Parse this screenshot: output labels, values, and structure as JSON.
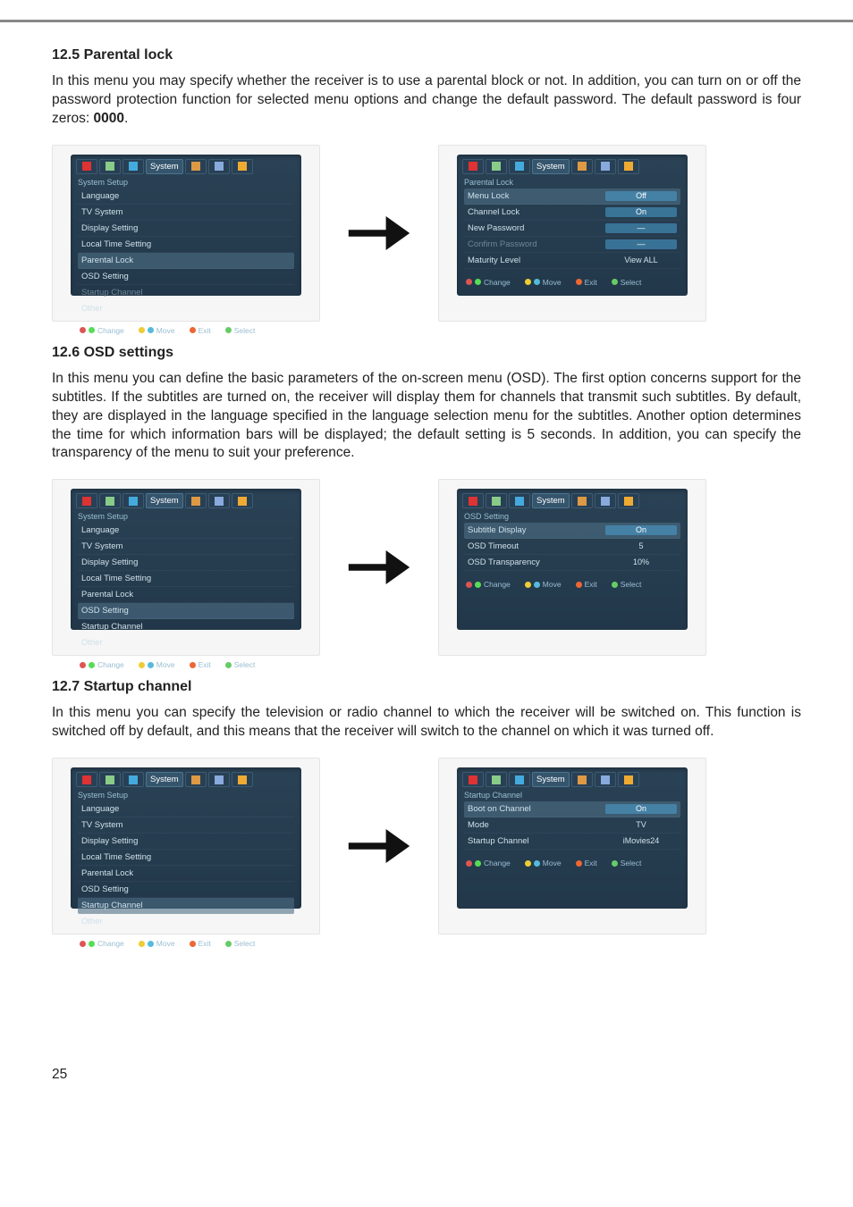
{
  "sections": {
    "s1": {
      "heading": "12.5 Parental lock",
      "body": "In this menu you may specify whether the receiver is to use a parental block or not. In addition, you can turn on or off the password protection function for selected menu options and change the default password. The default password is four zeros: ",
      "bold_tail": "0000",
      "tail": ".",
      "left": {
        "title": "System Setup",
        "items": [
          "Language",
          "TV System",
          "Display Setting",
          "Local Time Setting",
          "Parental Lock",
          "OSD Setting",
          "Startup Channel",
          "Other"
        ],
        "selected_index": 4,
        "disabled_index": 6
      },
      "right": {
        "title": "Parental Lock",
        "rows": [
          {
            "label": "Menu Lock",
            "value": "Off",
            "sel": true
          },
          {
            "label": "Channel Lock",
            "value": "On"
          },
          {
            "label": "New Password",
            "value": "—"
          },
          {
            "label": "Confirm Password",
            "value": "—",
            "dis": true
          },
          {
            "label": "Maturity Level",
            "value": "View ALL",
            "plain": true
          }
        ]
      }
    },
    "s2": {
      "heading": "12.6 OSD settings",
      "body": "In this menu you can define the basic parameters of the on-screen menu (OSD). The first option concerns support for the subtitles. If the subtitles are turned on, the receiver will display them for channels that transmit such subtitles. By default, they are displayed in the language specified in the language selection menu for the subtitles. Another option determines the time for which information bars will be displayed; the default setting is 5 seconds. In addition, you can specify the transparency of the menu to suit your preference.",
      "left": {
        "title": "System Setup",
        "items": [
          "Language",
          "TV System",
          "Display Setting",
          "Local Time Setting",
          "Parental Lock",
          "OSD Setting",
          "Startup Channel",
          "Other"
        ],
        "selected_index": 5
      },
      "right": {
        "title": "OSD Setting",
        "rows": [
          {
            "label": "Subtitle Display",
            "value": "On",
            "sel": true
          },
          {
            "label": "OSD Timeout",
            "value": "5",
            "plain": true
          },
          {
            "label": "OSD Transparency",
            "value": "10%",
            "plain": true
          }
        ]
      }
    },
    "s3": {
      "heading": "12.7 Startup channel",
      "body": "In this menu you can specify the television or radio channel to which the receiver will be switched on. This function is switched off by default, and this means that the receiver will switch to the channel on which it was turned off.",
      "left": {
        "title": "System Setup",
        "items": [
          "Language",
          "TV System",
          "Display Setting",
          "Local Time Setting",
          "Parental Lock",
          "OSD Setting",
          "Startup Channel",
          "Other"
        ],
        "selected_index": 6
      },
      "right": {
        "title": "Startup Channel",
        "rows": [
          {
            "label": "Boot on Channel",
            "value": "On",
            "sel": true
          },
          {
            "label": "Mode",
            "value": "TV",
            "plain": true
          },
          {
            "label": "Startup Channel",
            "value": "iMovies24",
            "plain": true
          }
        ]
      }
    }
  },
  "hints": {
    "change": "Change",
    "move": "Move",
    "exit": "Exit",
    "select": "Select"
  },
  "tabstrip_label": "System",
  "page_number": "25"
}
